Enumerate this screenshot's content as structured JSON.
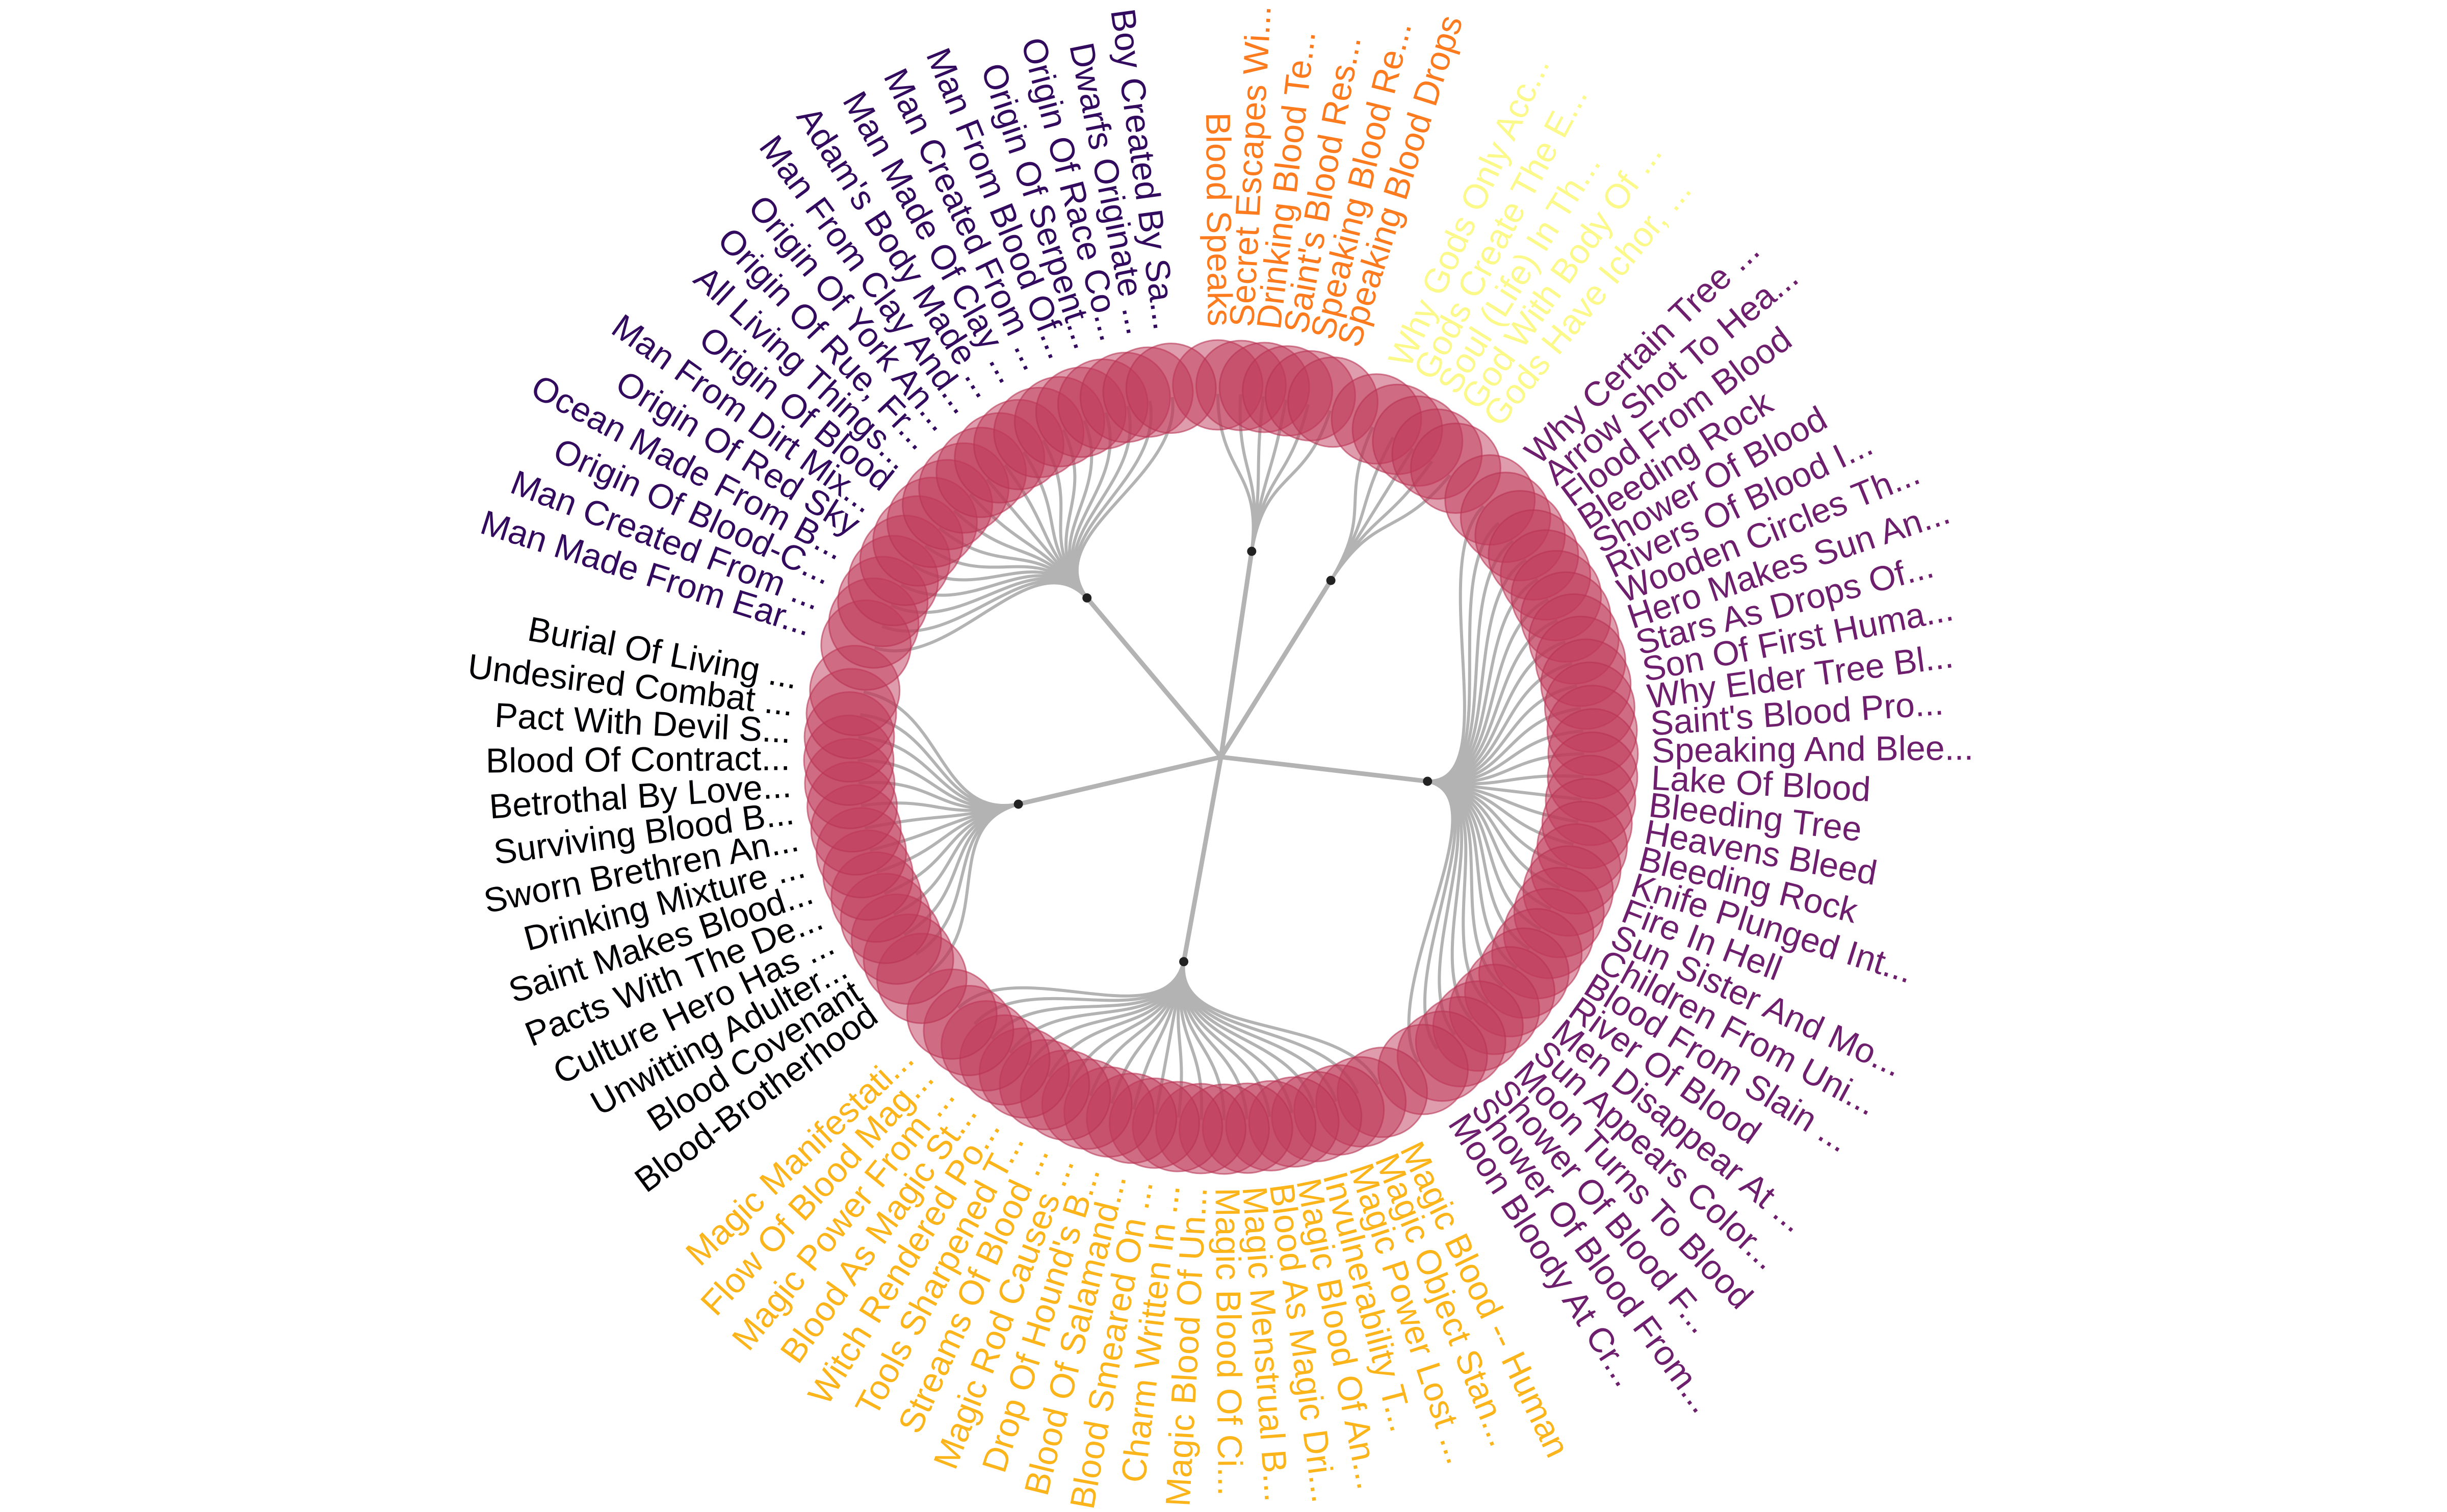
{
  "colors": {
    "link": "#b3b3b3",
    "node_fill": "#c0395a",
    "node_stroke": "#b83353"
  },
  "chart_data": {
    "type": "circular-dendrogram",
    "groups": [
      {
        "color": "#fb7b1e",
        "leaves": [
          "Blood Speaks",
          "Secret Escapes Wi...",
          "Drinking Blood Te...",
          "Saint's Blood Res...",
          "Speaking Blood Re...",
          "Speaking Blood Drops"
        ]
      },
      {
        "color": "#fbf98a",
        "leaves": [
          "Why Gods Only Acc...",
          "Gods Create The E...",
          "Soul (Life) In Th...",
          "God With Body Of ...",
          "Gods Have Ichor, ..."
        ]
      },
      {
        "color": "#6d1e6c",
        "leaves": [
          "Why Certain Tree ...",
          "Arrow Shot To Hea...",
          "Flood From Blood",
          "Bleeding Rock",
          "Shower Of Blood",
          "Rivers Of Blood I...",
          "Wooden Circles Th...",
          "Hero Makes Sun An...",
          "Stars As Drops Of...",
          "Son Of First Huma...",
          "Why Elder Tree Bl...",
          "Saint's Blood Pro...",
          "Speaking And Blee...",
          "Lake Of Blood",
          "Bleeding Tree",
          "Heavens Bleed",
          "Bleeding Rock",
          "Knife Plunged Int...",
          "Fire In Hell",
          "Sun Sister And Mo...",
          "Children From Uni...",
          "Blood From Slain ...",
          "River Of Blood",
          "Men Disappear At ...",
          "Sun Appears Color...",
          "Moon Turns To Blood",
          "Shower Of Blood F...",
          "Shower Of Blood From...",
          "Moon Bloody At Cr..."
        ]
      },
      {
        "color": "#fbb41a",
        "leaves": [
          "Magic Blood -- Human",
          "Magic Object Stan...",
          "Magic Power Lost ...",
          "Invulnerability T...",
          "Magic Blood Of An...",
          "Blood As Magic Dri...",
          "Magic Menstrual B...",
          "Magic Blood Of Ci...",
          "Magic Blood Of Un...",
          "Charm Written In ...",
          "Blood Smeared On ...",
          "Blood Of Salamand...",
          "Drop Of Hound's B...",
          "Magic Rod Causes ...",
          "Streams Of Blood ...",
          "Tools Sharpened T...",
          "Witch Rendered Po...",
          "Blood As Magic St...",
          "Magic Power From ...",
          "Flow Of Blood Mag...",
          "Magic Manifestati..."
        ]
      },
      {
        "color": "#000004",
        "leaves": [
          "Blood-Brotherhood",
          "Blood Covenant",
          "Unwitting Adulter...",
          "Culture Hero Has ...",
          "Pacts With The De...",
          "Saint Makes Blood...",
          "Drinking Mixture ...",
          "Sworn Brethren An...",
          "Surviving Blood B...",
          "Betrothal By Love...",
          "Blood Of Contract...",
          "Pact With Devil S...",
          "Undesired Combat ...",
          "Burial Of Living ..."
        ]
      },
      {
        "color": "#320a5e",
        "leaves": [
          "Man Made From Ear...",
          "Man Created From ...",
          "Origin Of Blood-C...",
          "Ocean Made From B...",
          "Origin Of Red Sky",
          "Man From Dirt Mix...",
          "Origin Of Blood",
          "All Living Things...",
          "Origin Of Rue, Fr...",
          "Origin Of York An...",
          "Man From Clay And...",
          "Adam's Body Made ...",
          "Man Made Of Clay ...",
          "Man Created From ...",
          "Man From Blood Of...",
          "Origin Of Serpent...",
          "Origin Of Race Co...",
          "Dwarfs Originate ...",
          "Boy Created By Sa..."
        ]
      }
    ]
  }
}
